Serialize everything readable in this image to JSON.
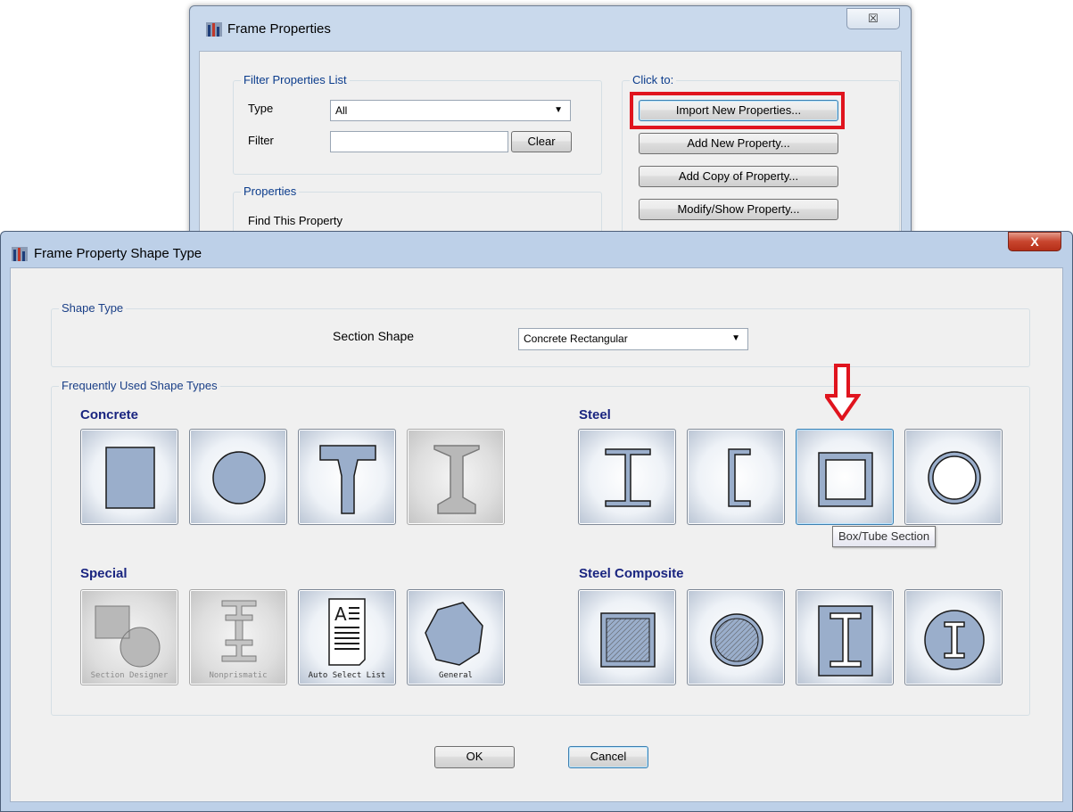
{
  "frame_properties": {
    "title": "Frame Properties",
    "close_glyph": "☒",
    "filter_group": {
      "legend": "Filter Properties List",
      "type_label": "Type",
      "type_value": "All",
      "filter_label": "Filter",
      "filter_value": "",
      "clear_label": "Clear"
    },
    "click_to": {
      "legend": "Click to:",
      "import_label": "Import New Properties...",
      "add_new_label": "Add New Property...",
      "add_copy_label": "Add Copy of Property...",
      "modify_label": "Modify/Show Property..."
    },
    "properties_group": {
      "legend": "Properties",
      "find_label": "Find This Property"
    }
  },
  "shape_dialog": {
    "title": "Frame Property Shape Type",
    "close_glyph": "X",
    "shape_type": {
      "legend": "Shape Type",
      "section_shape_label": "Section Shape",
      "section_shape_value": "Concrete Rectangular"
    },
    "frequently_used": {
      "legend": "Frequently Used Shape Types",
      "concrete_heading": "Concrete",
      "steel_heading": "Steel",
      "special_heading": "Special",
      "steel_composite_heading": "Steel Composite",
      "captions": {
        "section_designer": "Section Designer",
        "nonprismatic": "Nonprismatic",
        "auto_select_list": "Auto Select List",
        "general": "General"
      }
    },
    "tooltip": "Box/Tube Section",
    "ok_label": "OK",
    "cancel_label": "Cancel"
  },
  "colors": {
    "shape_fill": "#9aaecb",
    "shape_stroke": "#1a1a1a",
    "disabled_fill": "#b8b8b8",
    "highlight_red": "#e0141e",
    "heading_navy": "#1a2580"
  },
  "icons": {
    "app_icon": "etabs-bars-icon",
    "down_arrow": "red-down-arrow-icon"
  }
}
